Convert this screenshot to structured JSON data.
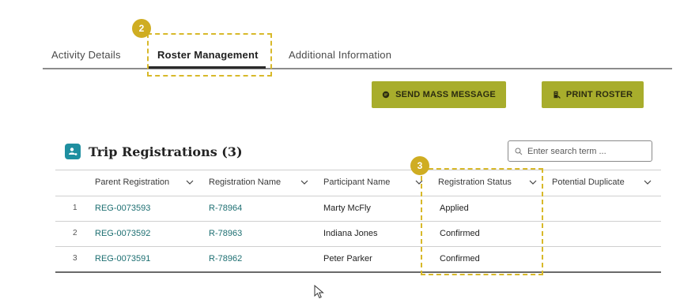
{
  "tabs": [
    {
      "label": "Activity Details"
    },
    {
      "label": "Roster Management"
    },
    {
      "label": "Additional Information"
    }
  ],
  "callouts": {
    "tab_marker": "2",
    "column_marker": "3"
  },
  "actions": {
    "send_mass_message": "SEND MASS MESSAGE",
    "print_roster": "PRINT ROSTER"
  },
  "section": {
    "title": "Trip Registrations (3)"
  },
  "search": {
    "placeholder": "Enter search term ..."
  },
  "table": {
    "columns": [
      "Parent Registration",
      "Registration Name",
      "Participant Name",
      "Registration Status",
      "Potential Duplicate"
    ],
    "rows": [
      {
        "num": "1",
        "parent": "REG-0073593",
        "reg": "R-78964",
        "participant": "Marty McFly",
        "status": "Applied"
      },
      {
        "num": "2",
        "parent": "REG-0073592",
        "reg": "R-78963",
        "participant": "Indiana Jones",
        "status": "Confirmed"
      },
      {
        "num": "3",
        "parent": "REG-0073591",
        "reg": "R-78962",
        "participant": "Peter Parker",
        "status": "Confirmed"
      }
    ]
  },
  "colors": {
    "accent_button": "#a8ad2c",
    "callout": "#cfad22",
    "link": "#1d6f72",
    "title_icon": "#1f8fa0"
  }
}
